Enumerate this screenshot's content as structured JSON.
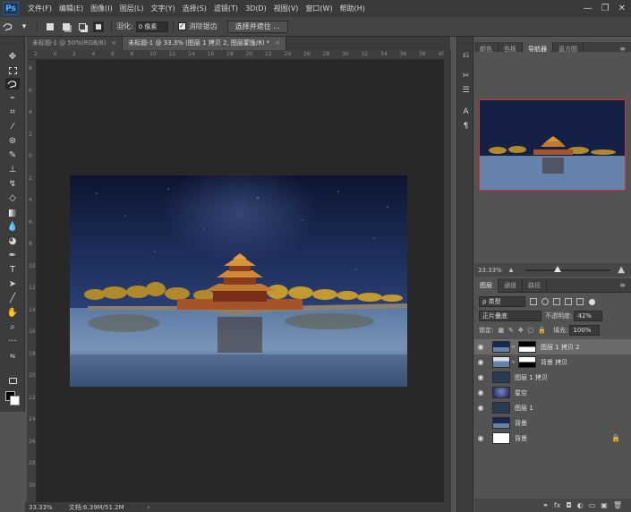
{
  "app": {
    "logo": "Ps",
    "window_controls": [
      "—",
      "❐",
      "✕"
    ]
  },
  "menu": [
    "文件(F)",
    "编辑(E)",
    "图像(I)",
    "图层(L)",
    "文字(Y)",
    "选择(S)",
    "滤镜(T)",
    "3D(D)",
    "视图(V)",
    "窗口(W)",
    "帮助(H)"
  ],
  "options": {
    "feather_label": "羽化:",
    "feather_value": "0 像素",
    "antialias_label": "消除锯齿",
    "select_mask_button": "选择并遮住 ..."
  },
  "tabs": [
    {
      "label": "未标题-1 @ 50%(RGB/8)",
      "close": "×"
    },
    {
      "label": "未标题-1 @ 33.3% (图层 1 拷贝 2, 图层蒙版/8) *",
      "close": "×"
    }
  ],
  "ruler_top": [
    "2",
    "0",
    "2",
    "4",
    "6",
    "8",
    "10",
    "12",
    "14",
    "16",
    "18",
    "20",
    "22",
    "24",
    "26",
    "28",
    "30",
    "32",
    "34",
    "36",
    "38",
    "40"
  ],
  "ruler_left": [
    "8",
    "6",
    "4",
    "2",
    "0",
    "2",
    "4",
    "6",
    "8",
    "10",
    "12",
    "14",
    "16",
    "18",
    "20",
    "22",
    "24",
    "26",
    "28",
    "30"
  ],
  "status": {
    "zoom": "33.33%",
    "doc": "文档:6.39M/51.2M",
    "arrow": "›"
  },
  "nav_panel": {
    "tabs": [
      "颜色",
      "色板",
      "导航器",
      "直方图"
    ],
    "active_tab": "导航器",
    "zoom": "33.33%"
  },
  "layers_panel": {
    "tabs": [
      "图层",
      "通道",
      "路径"
    ],
    "active_tab": "图层",
    "filter_kind": "ρ 类型",
    "blend_mode": "正片叠底",
    "opacity_label": "不透明度:",
    "opacity_value": "42%",
    "opacity_fraction": 0.42,
    "lock_label": "锁定:",
    "fill_label": "填充:",
    "fill_value": "100%",
    "layers": [
      {
        "name": "图层 1 拷贝 2",
        "visible": true,
        "mask": true,
        "selected": true,
        "thumb": "scene"
      },
      {
        "name": "背景 拷贝",
        "visible": true,
        "mask": true,
        "selected": false,
        "thumb": "scene2"
      },
      {
        "name": "图层 1 拷贝",
        "visible": true,
        "mask": false,
        "selected": false,
        "thumb": "dark"
      },
      {
        "name": "星空",
        "visible": true,
        "mask": false,
        "selected": false,
        "thumb": "sky"
      },
      {
        "name": "图层 1",
        "visible": true,
        "mask": false,
        "selected": false,
        "thumb": "dark"
      },
      {
        "name": "背景",
        "visible": false,
        "mask": false,
        "selected": false,
        "thumb": "scene"
      },
      {
        "name": "背景",
        "visible": true,
        "mask": false,
        "selected": false,
        "thumb": "white",
        "locked": true
      }
    ],
    "footer_icons": [
      "⚭",
      "fx",
      "◘",
      "◐",
      "▭",
      "▣",
      "🗑"
    ]
  },
  "colors": {
    "accent_red": "#d23030",
    "panel_bg": "#535353",
    "canvas_bg": "#282828",
    "sky_top": "#101a3a",
    "sky_mid": "#1e2d5a",
    "water": "#6f8bb0"
  }
}
